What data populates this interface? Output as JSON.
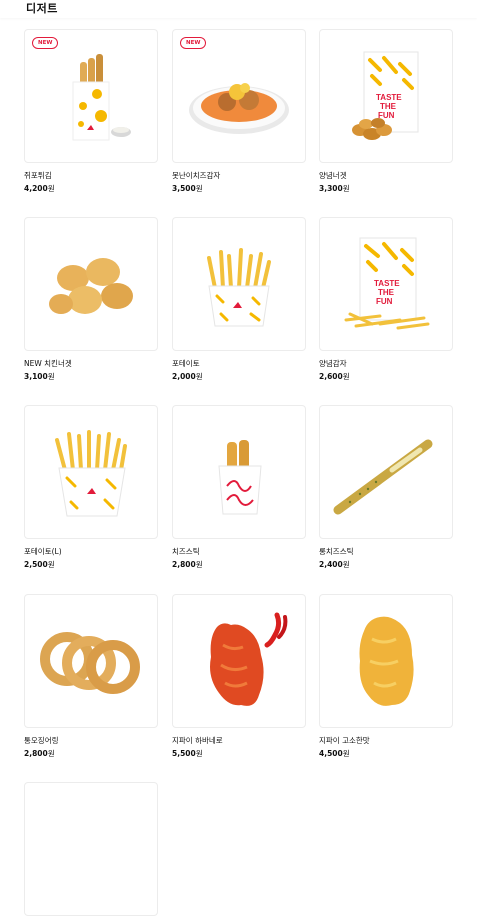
{
  "section": {
    "title": "디저트"
  },
  "currency": "원",
  "badge_new": "NEW",
  "products": [
    {
      "name": "쥐포튀김",
      "price": "4,200",
      "is_new": true,
      "icon": "squid-fries-image"
    },
    {
      "name": "못난이치즈감자",
      "price": "3,500",
      "is_new": true,
      "icon": "cheese-potato-plate-image"
    },
    {
      "name": "양념너겟",
      "price": "3,300",
      "is_new": false,
      "icon": "seasoned-nugget-bag-image"
    },
    {
      "name": "NEW 치킨너겟",
      "price": "3,100",
      "is_new": false,
      "icon": "chicken-nuggets-image"
    },
    {
      "name": "포테이토",
      "price": "2,000",
      "is_new": false,
      "icon": "potato-fries-image"
    },
    {
      "name": "양념감자",
      "price": "2,600",
      "is_new": false,
      "icon": "seasoned-fries-bag-image"
    },
    {
      "name": "포테이토(L)",
      "price": "2,500",
      "is_new": false,
      "icon": "large-fries-image"
    },
    {
      "name": "치즈스틱",
      "price": "2,800",
      "is_new": false,
      "icon": "cheese-stick-image"
    },
    {
      "name": "롱치즈스틱",
      "price": "2,400",
      "is_new": false,
      "icon": "long-cheese-stick-image"
    },
    {
      "name": "통오징어링",
      "price": "2,800",
      "is_new": false,
      "icon": "squid-rings-image"
    },
    {
      "name": "지파이 하바네로",
      "price": "5,500",
      "is_new": false,
      "icon": "zpie-habanero-image"
    },
    {
      "name": "지파이 고소한맛",
      "price": "4,500",
      "is_new": false,
      "icon": "zpie-original-image"
    }
  ],
  "colors": {
    "accent": "#e21b3b",
    "fry": "#f6c23a",
    "brand_yellow": "#f5b800",
    "fried": "#e9a43a"
  }
}
